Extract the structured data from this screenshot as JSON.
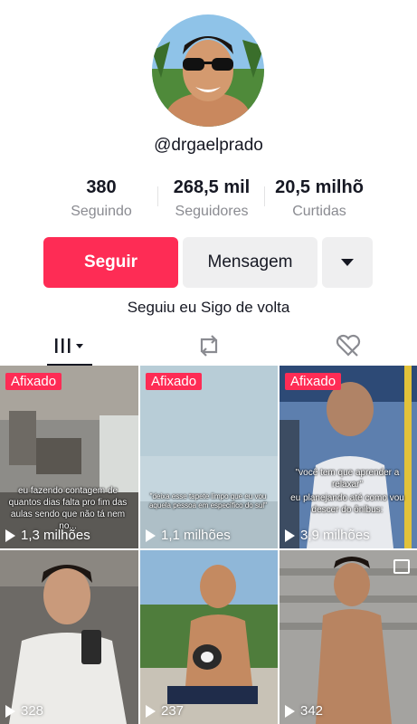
{
  "profile": {
    "username": "@drgaelprado",
    "bio": "Seguiu eu Sigo de volta"
  },
  "stats": [
    {
      "value": "380",
      "label": "Seguindo"
    },
    {
      "value": "268,5 mil",
      "label": "Seguidores"
    },
    {
      "value": "20,5 milhõ",
      "label": "Curtidas"
    }
  ],
  "actions": {
    "follow_label": "Seguir",
    "message_label": "Mensagem"
  },
  "tabs": [
    {
      "icon": "grid-icon",
      "active": true
    },
    {
      "icon": "repost-icon",
      "active": false
    },
    {
      "icon": "liked-hidden-icon",
      "active": false
    }
  ],
  "videos": [
    {
      "pinned_label": "Afixado",
      "views": "1,3 milhões",
      "caption": "eu fazendo contagem de quantos dias falta pro fim das aulas sendo que não tá nem no..."
    },
    {
      "pinned_label": "Afixado",
      "views": "1,1 milhões",
      "caption": "\"deixa esse tapete limpo que eu vou aquela pessoa em específico do sul\""
    },
    {
      "pinned_label": "Afixado",
      "views": "3,9 milhões",
      "caption": "\"você tem que aprender a relaxar\"",
      "caption2": "eu planejando até como vou descer do ônibus:"
    },
    {
      "views": "328"
    },
    {
      "views": "237"
    },
    {
      "views": "342"
    }
  ],
  "colors": {
    "accent": "#fe2c55",
    "text": "#161823",
    "muted": "#8a8b91",
    "button_bg": "#efeff0"
  }
}
